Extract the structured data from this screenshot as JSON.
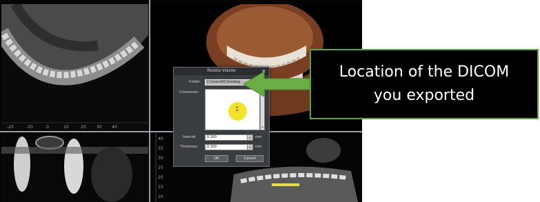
{
  "dialog": {
    "title": "Reslice Volume",
    "close_glyph": "✕",
    "folder_label": "Folder:",
    "folder_value": "C:\\Users\\MC\\Desktop",
    "comments_label": "Comments:",
    "interval_label": "Interval:",
    "interval_value": "0.160",
    "thickness_label": "Thickness:",
    "thickness_value": "0.160",
    "unit": "mm",
    "ok_label": "OK",
    "cancel_label": "Cancel",
    "dropdown_glyph": "▾"
  },
  "callout": {
    "line1": "Location of the DICOM",
    "line2": "you exported"
  },
  "axial_ruler": [
    "-20",
    "-10",
    "0",
    "10",
    "20",
    "30",
    "40"
  ],
  "sagittal_ruler": [
    "40",
    "35",
    "30",
    "25",
    "20",
    "15",
    "10"
  ],
  "colors": {
    "accent_arrow": "#6aae45",
    "callout_border": "#5aa73c",
    "highlight": "#f2e01a"
  },
  "icons": [
    "close-icon",
    "dropdown-icon",
    "text-cursor-icon",
    "arrow-icon"
  ]
}
